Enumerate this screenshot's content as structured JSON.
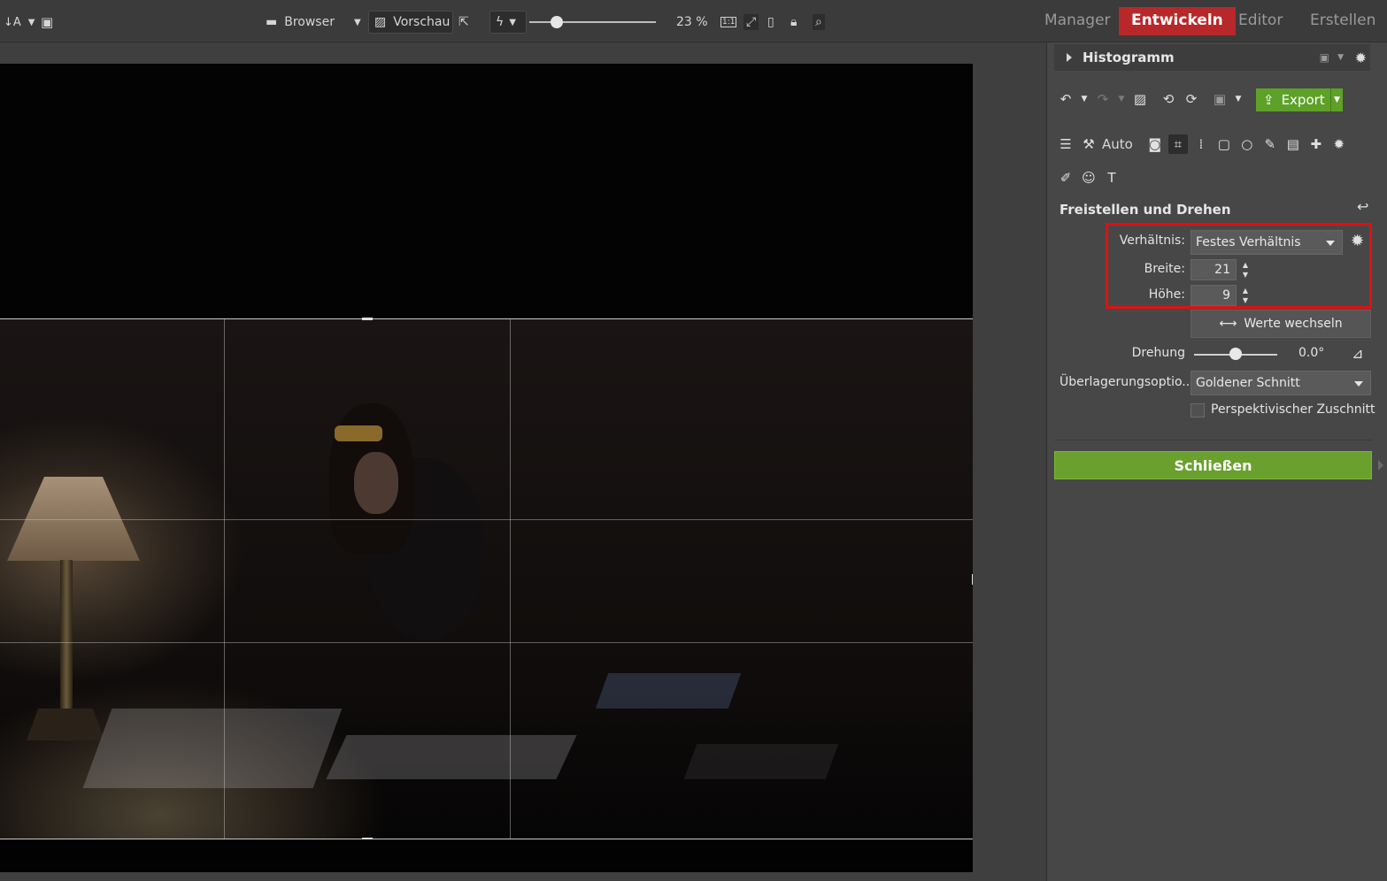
{
  "topbar": {
    "browser_label": "Browser",
    "preview_label": "Vorschau",
    "zoom_value": 0.23,
    "zoom_label": "23 %",
    "one_to_one_label": "1:1"
  },
  "modes": {
    "manager": "Manager",
    "develop": "Entwickeln",
    "editor": "Editor",
    "create": "Erstellen"
  },
  "panel": {
    "histogram_title": "Histogramm",
    "export_label": "Export",
    "auto_label": "Auto",
    "section_title": "Freistellen und Drehen",
    "ratio_label": "Verhältnis:",
    "ratio_value": "Festes Verhältnis",
    "width_label": "Breite:",
    "width_value": "21",
    "height_label": "Höhe:",
    "height_value": "9",
    "swap_label": "Werte wechseln",
    "rotation_label": "Drehung",
    "rotation_value": "0.0°",
    "rotation_level": 0.5,
    "overlay_label": "Überlagerungsoptio...",
    "overlay_value": "Goldener Schnitt",
    "perspective_label": "Perspektivischer Zuschnitt",
    "perspective_checked": false,
    "close_label": "Schließen"
  },
  "colors": {
    "accent_red": "#b8282a",
    "export_green": "#5ea128",
    "close_green": "#6aa02e",
    "highlight_red": "#e01010"
  }
}
